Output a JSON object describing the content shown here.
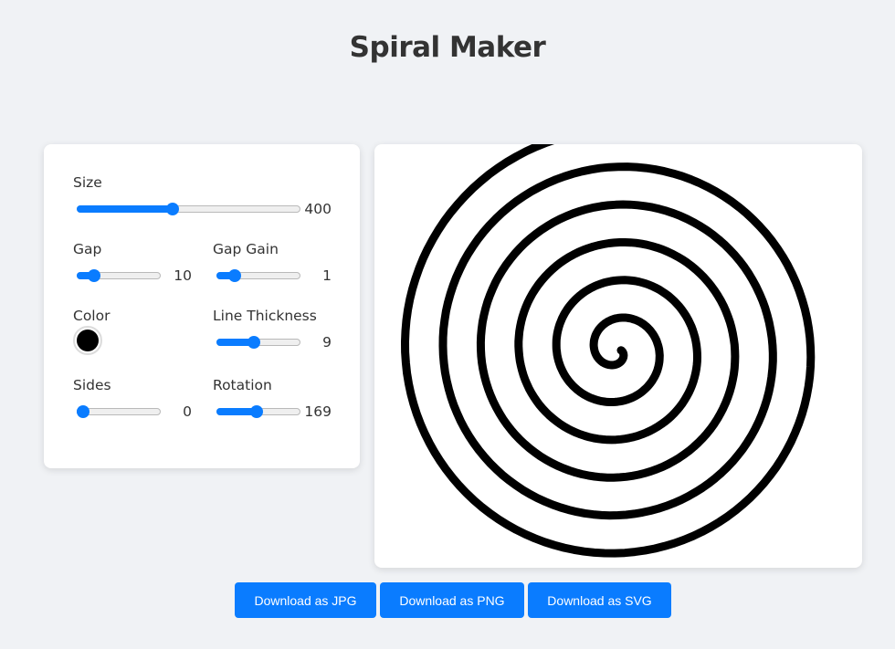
{
  "app": {
    "title": "Spiral Maker"
  },
  "controls": {
    "size": {
      "label": "Size",
      "value": "400",
      "fraction": 0.425
    },
    "gap": {
      "label": "Gap",
      "value": "10",
      "fraction": 0.16
    },
    "gap_gain": {
      "label": "Gap Gain",
      "value": "1",
      "fraction": 0.17
    },
    "color": {
      "label": "Color",
      "value": "#000000"
    },
    "line_thickness": {
      "label": "Line Thickness",
      "value": "9",
      "fraction": 0.43
    },
    "sides": {
      "label": "Sides",
      "value": "0",
      "fraction": 0.0
    },
    "rotation": {
      "label": "Rotation",
      "value": "169",
      "fraction": 0.47
    }
  },
  "buttons": {
    "jpg": "Download as JPG",
    "png": "Download as PNG",
    "svg": "Download as SVG"
  },
  "colors": {
    "accent": "#0a7cff",
    "background": "#f0f2f5",
    "spiral": "#000000"
  }
}
